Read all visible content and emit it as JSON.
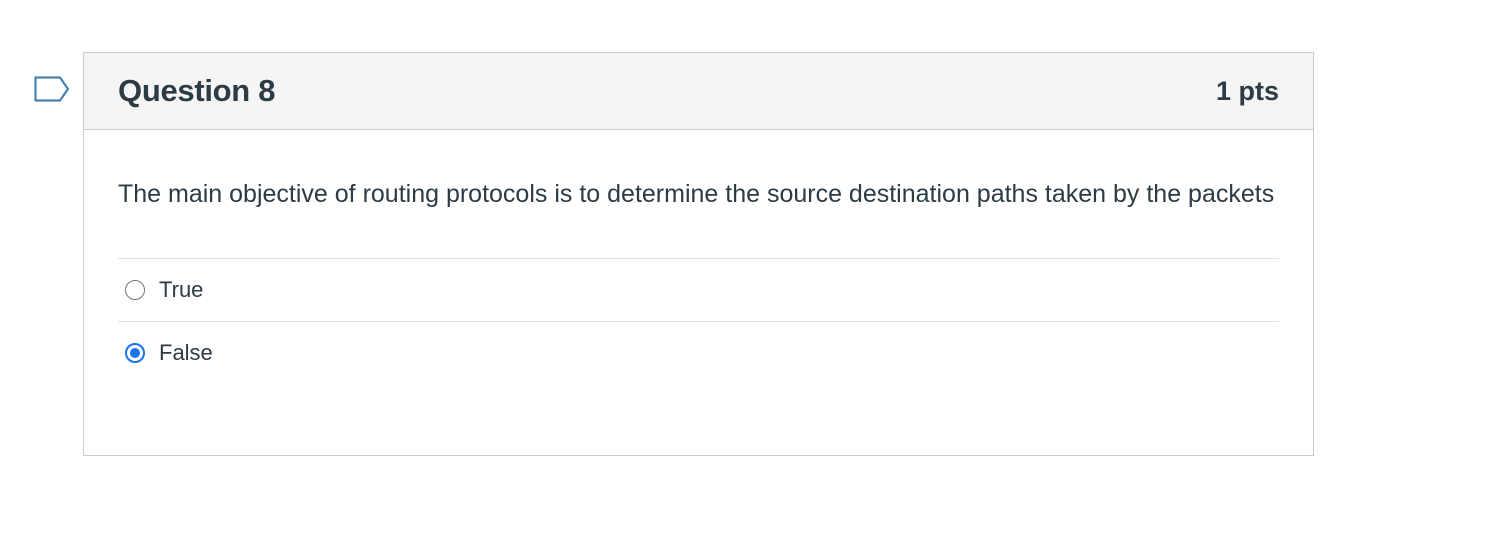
{
  "question": {
    "title": "Question 8",
    "points": "1 pts",
    "text": "The main objective of routing protocols is to determine the source destination paths taken by the packets",
    "answers": [
      {
        "label": "True",
        "selected": false
      },
      {
        "label": "False",
        "selected": true
      }
    ]
  },
  "colors": {
    "accent": "#1a73e8",
    "text": "#2d3b45",
    "header_bg": "#f5f5f5",
    "border": "#c7cdd1"
  },
  "icons": {
    "flag": "flag-question-icon"
  }
}
